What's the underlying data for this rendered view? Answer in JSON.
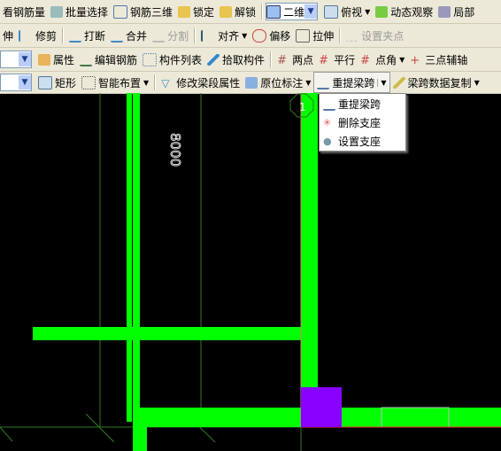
{
  "toolbar1": {
    "items": [
      "看钢筋量",
      "批量选择",
      "钢筋三维",
      "锁定",
      "解锁"
    ],
    "view_mode": "二维",
    "view_dir": "俯视",
    "orbit": "动态观察",
    "local": "局部"
  },
  "toolbar2": {
    "items": [
      "伸",
      "修剪",
      "打断",
      "合并",
      "分割",
      "对齐",
      "偏移",
      "拉伸",
      "设置夹点"
    ]
  },
  "toolbar3": {
    "items": [
      "属性",
      "编辑钢筋",
      "构件列表",
      "拾取构件",
      "两点",
      "平行",
      "点角",
      "三点辅轴"
    ]
  },
  "toolbar4": {
    "items": [
      "矩形",
      "智能布置",
      "修改梁段属性",
      "原位标注",
      "重提梁跨",
      "梁跨数据复制"
    ]
  },
  "menu": {
    "items": [
      "重提梁跨",
      "删除支座",
      "设置支座"
    ]
  },
  "canvas": {
    "dimension": "8000",
    "axis_label": "1",
    "colors": {
      "beam": "#00ff00",
      "column": "#8800ff",
      "axis": "#2e7d1e"
    }
  }
}
